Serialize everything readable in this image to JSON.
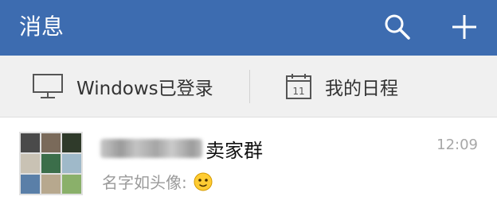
{
  "header": {
    "title": "消息",
    "icons": [
      "search-icon",
      "plus-icon"
    ]
  },
  "quick_actions": {
    "windows_label": "Windows已登录",
    "windows_icon": "monitor-icon",
    "calendar_label": "我的日程",
    "calendar_icon": "calendar-icon",
    "calendar_day": "11"
  },
  "chat_list": [
    {
      "name": "卖家群",
      "time": "12:09",
      "preview": "名字如头像:",
      "preview_emoji": "smiley-emoji-icon"
    }
  ],
  "colors": {
    "header_bg": "#3d6cb0",
    "quickrow_bg": "#f0f0f0",
    "list_bg": "#ffffff",
    "time_text": "#a7a7a7",
    "preview_text": "#9a9a9a"
  }
}
